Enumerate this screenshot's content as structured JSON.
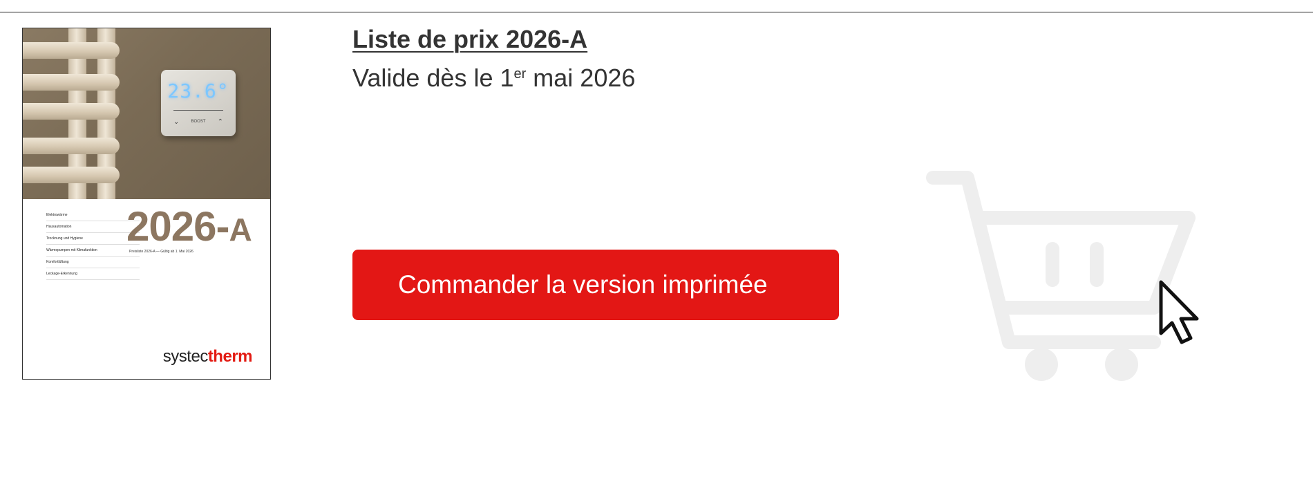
{
  "pricelist": {
    "title": "Liste de prix 2026-A",
    "valid_prefix": "Valide dès le 1",
    "valid_sup": "er",
    "valid_suffix": " mai 2026"
  },
  "cover": {
    "thermostat_display": "23.6°",
    "thermostat_boost": "BOOST",
    "menu_items": [
      "Elektrowärme",
      "Hausautomation",
      "Trocknung und Hygiene",
      "Wärmepumpen mit Klimafunktion",
      "Komfortlüftung",
      "Leckage-Erkennung"
    ],
    "year": "2026-",
    "year_suffix": "A",
    "subtitle": "Preisliste 2026-A — Gültig ab 1. Mai 2026",
    "brand_regular": "systec",
    "brand_bold": "therm"
  },
  "order_button": {
    "label": "Commander la version imprimée"
  },
  "colors": {
    "accent_red": "#e31715",
    "cover_brown": "#8c7660",
    "cart_gray": "#eeeeee"
  },
  "icons": {
    "cart": "shopping-cart-icon",
    "cursor": "mouse-pointer-icon"
  }
}
